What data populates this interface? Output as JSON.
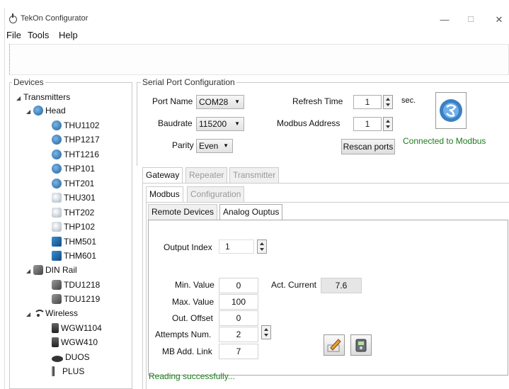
{
  "window": {
    "title": "TekOn Configurator",
    "minimize": "—",
    "maximize": "☐",
    "close": "✕"
  },
  "menu": {
    "file": "File",
    "tools": "Tools",
    "help": "Help"
  },
  "devices": {
    "group_label": "Devices",
    "root": "Transmitters",
    "head": {
      "label": "Head",
      "items": [
        "THU1102",
        "THP1217",
        "THT1216",
        "THP101",
        "THT201",
        "THU301",
        "THT202",
        "THP102",
        "THM501",
        "THM601"
      ]
    },
    "din_rail": {
      "label": "DIN Rail",
      "items": [
        "TDU1218",
        "TDU1219"
      ]
    },
    "wireless": {
      "label": "Wireless",
      "items": [
        "WGW1104",
        "WGW410",
        "DUOS",
        "PLUS"
      ]
    }
  },
  "serial": {
    "group_label": "Serial Port Configuration",
    "port_name_label": "Port Name",
    "port_name": "COM28",
    "baudrate_label": "Baudrate",
    "baudrate": "115200",
    "parity_label": "Parity",
    "parity": "Even",
    "refresh_label": "Refresh Time",
    "refresh_value": "1",
    "refresh_unit": "sec.",
    "modbus_addr_label": "Modbus Address",
    "modbus_addr": "1",
    "rescan": "Rescan ports",
    "connection_status": "Connected to Modbus"
  },
  "tabs": {
    "level1": [
      "Gateway",
      "Repeater",
      "Transmitter"
    ],
    "level2": [
      "Modbus",
      "Configuration"
    ],
    "level3": [
      "Remote Devices",
      "Analog Ouptus"
    ]
  },
  "analog": {
    "output_index_label": "Output Index",
    "output_index": "1",
    "min_label": "Min. Value",
    "min": "0",
    "max_label": "Max. Value",
    "max": "100",
    "offset_label": "Out. Offset",
    "offset": "0",
    "attempts_label": "Attempts Num.",
    "attempts": "2",
    "mb_link_label": "MB Add. Link",
    "mb_link": "7",
    "act_current_label": "Act. Current",
    "act_current": "7.6"
  },
  "status_message": "Reading successfully..."
}
